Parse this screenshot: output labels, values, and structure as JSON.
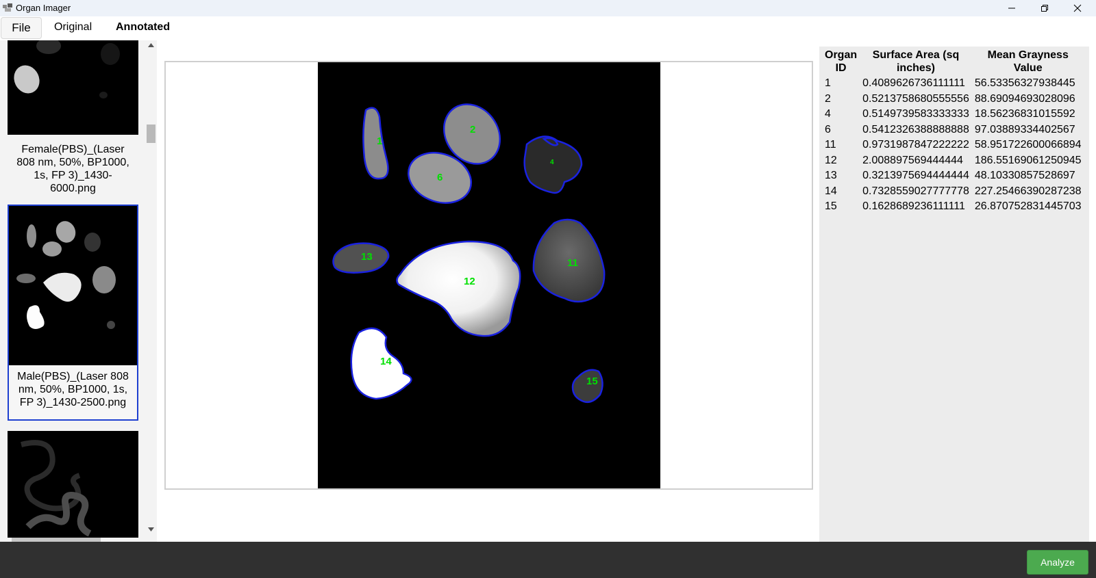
{
  "window": {
    "title": "Organ Imager",
    "icons": [
      "app-icon",
      "minimize-icon",
      "restore-icon",
      "close-icon"
    ]
  },
  "menu": {
    "file": "File",
    "tabs": [
      {
        "label": "Original",
        "active": false
      },
      {
        "label": "Annotated",
        "active": true
      }
    ]
  },
  "sidebar": {
    "items": [
      {
        "label": "Female(PBS)_(Laser 808 nm, 50%, BP1000, 1s, FP 3)_1430-6000.png",
        "label_lines": [
          "Female(PBS)_(Laser",
          "808 nm, 50%, BP1000,",
          "1s, FP 3)_1430-",
          "6000.png"
        ],
        "selected": false
      },
      {
        "label": "Male(PBS)_(Laser 808 nm, 50%, BP1000, 1s, FP 3)_1430-2500.png",
        "label_lines": [
          "Male(PBS)_(Laser 808",
          "nm, 50%, BP1000, 1s,",
          "FP 3)_1430-2500.png"
        ],
        "selected": true
      },
      {
        "label": "",
        "label_lines": [],
        "selected": false
      }
    ]
  },
  "viewer": {
    "organ_labels": [
      "1",
      "2",
      "4",
      "6",
      "11",
      "12",
      "13",
      "14",
      "15"
    ],
    "outline_color": "#1a22e0",
    "label_color": "#00e000"
  },
  "table": {
    "headers": [
      "Organ ID",
      "Surface Area (sq inches)",
      "Mean Grayness Value"
    ],
    "header_lines": [
      [
        "Organ",
        "ID"
      ],
      [
        "Surface Area (sq",
        "inches)"
      ],
      [
        "Mean Grayness",
        "Value"
      ]
    ],
    "rows": [
      [
        "1",
        "0.4089626736111111",
        "56.53356327938445"
      ],
      [
        "2",
        "0.5213758680555556",
        "88.69094693028096"
      ],
      [
        "4",
        "0.5149739583333333",
        "18.56236831015592"
      ],
      [
        "6",
        "0.5412326388888888",
        "97.03889334402567"
      ],
      [
        "11",
        "0.9731987847222222",
        "58.951722600066894"
      ],
      [
        "12",
        "2.008897569444444",
        "186.55169061250945"
      ],
      [
        "13",
        "0.3213975694444444",
        "48.10330857528697"
      ],
      [
        "14",
        "0.7328559027777778",
        "227.25466390287238"
      ],
      [
        "15",
        "0.1628689236111111",
        "26.870752831445703"
      ]
    ]
  },
  "footer": {
    "analyze_label": "Analyze",
    "analyze_color": "#4caa4f"
  }
}
